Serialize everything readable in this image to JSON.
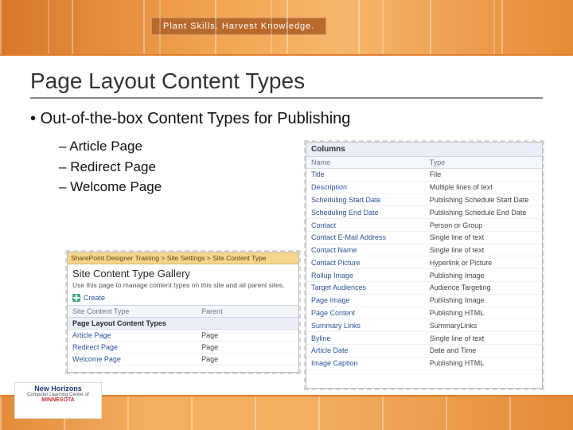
{
  "header": {
    "tagline": "Plant Skills. Harvest Knowledge."
  },
  "title": "Page Layout Content Types",
  "bullets": {
    "level1": "Out-of-the-box Content Types for Publishing",
    "level2": [
      "Article Page",
      "Redirect Page",
      "Welcome Page"
    ]
  },
  "left_shot": {
    "breadcrumb": "SharePoint Designer Training > Site Settings > Site Content Type",
    "heading": "Site Content Type Gallery",
    "description": "Use this page to manage content types on this site and all parent sites.",
    "create": "Create",
    "thead": {
      "c1": "Site Content Type",
      "c2": "Parent"
    },
    "group": "Page Layout Content Types",
    "rows": [
      {
        "name": "Article Page",
        "parent": "Page"
      },
      {
        "name": "Redirect Page",
        "parent": "Page"
      },
      {
        "name": "Welcome Page",
        "parent": "Page"
      }
    ]
  },
  "right_shot": {
    "section": "Columns",
    "thead": {
      "c1": "Name",
      "c2": "Type"
    },
    "rows": [
      {
        "name": "Title",
        "type": "File"
      },
      {
        "name": "Description",
        "type": "Multiple lines of text"
      },
      {
        "name": "Scheduling Start Date",
        "type": "Publishing Schedule Start Date"
      },
      {
        "name": "Scheduling End Date",
        "type": "Publishing Schedule End Date"
      },
      {
        "name": "Contact",
        "type": "Person or Group"
      },
      {
        "name": "Contact E-Mail Address",
        "type": "Single line of text"
      },
      {
        "name": "Contact Name",
        "type": "Single line of text"
      },
      {
        "name": "Contact Picture",
        "type": "Hyperlink or Picture"
      },
      {
        "name": "Rollup Image",
        "type": "Publishing Image"
      },
      {
        "name": "Target Audiences",
        "type": "Audience Targeting"
      },
      {
        "name": "Page Image",
        "type": "Publishing Image"
      },
      {
        "name": "Page Content",
        "type": "Publishing HTML"
      },
      {
        "name": "Summary Links",
        "type": "SummaryLinks"
      },
      {
        "name": "Byline",
        "type": "Single line of text"
      },
      {
        "name": "Article Date",
        "type": "Date and Time"
      },
      {
        "name": "Image Caption",
        "type": "Publishing HTML"
      }
    ]
  },
  "footer": {
    "logo_top": "New Horizons",
    "logo_sub": "Computer Learning Center of",
    "logo_mn": "MINNESOTA"
  }
}
